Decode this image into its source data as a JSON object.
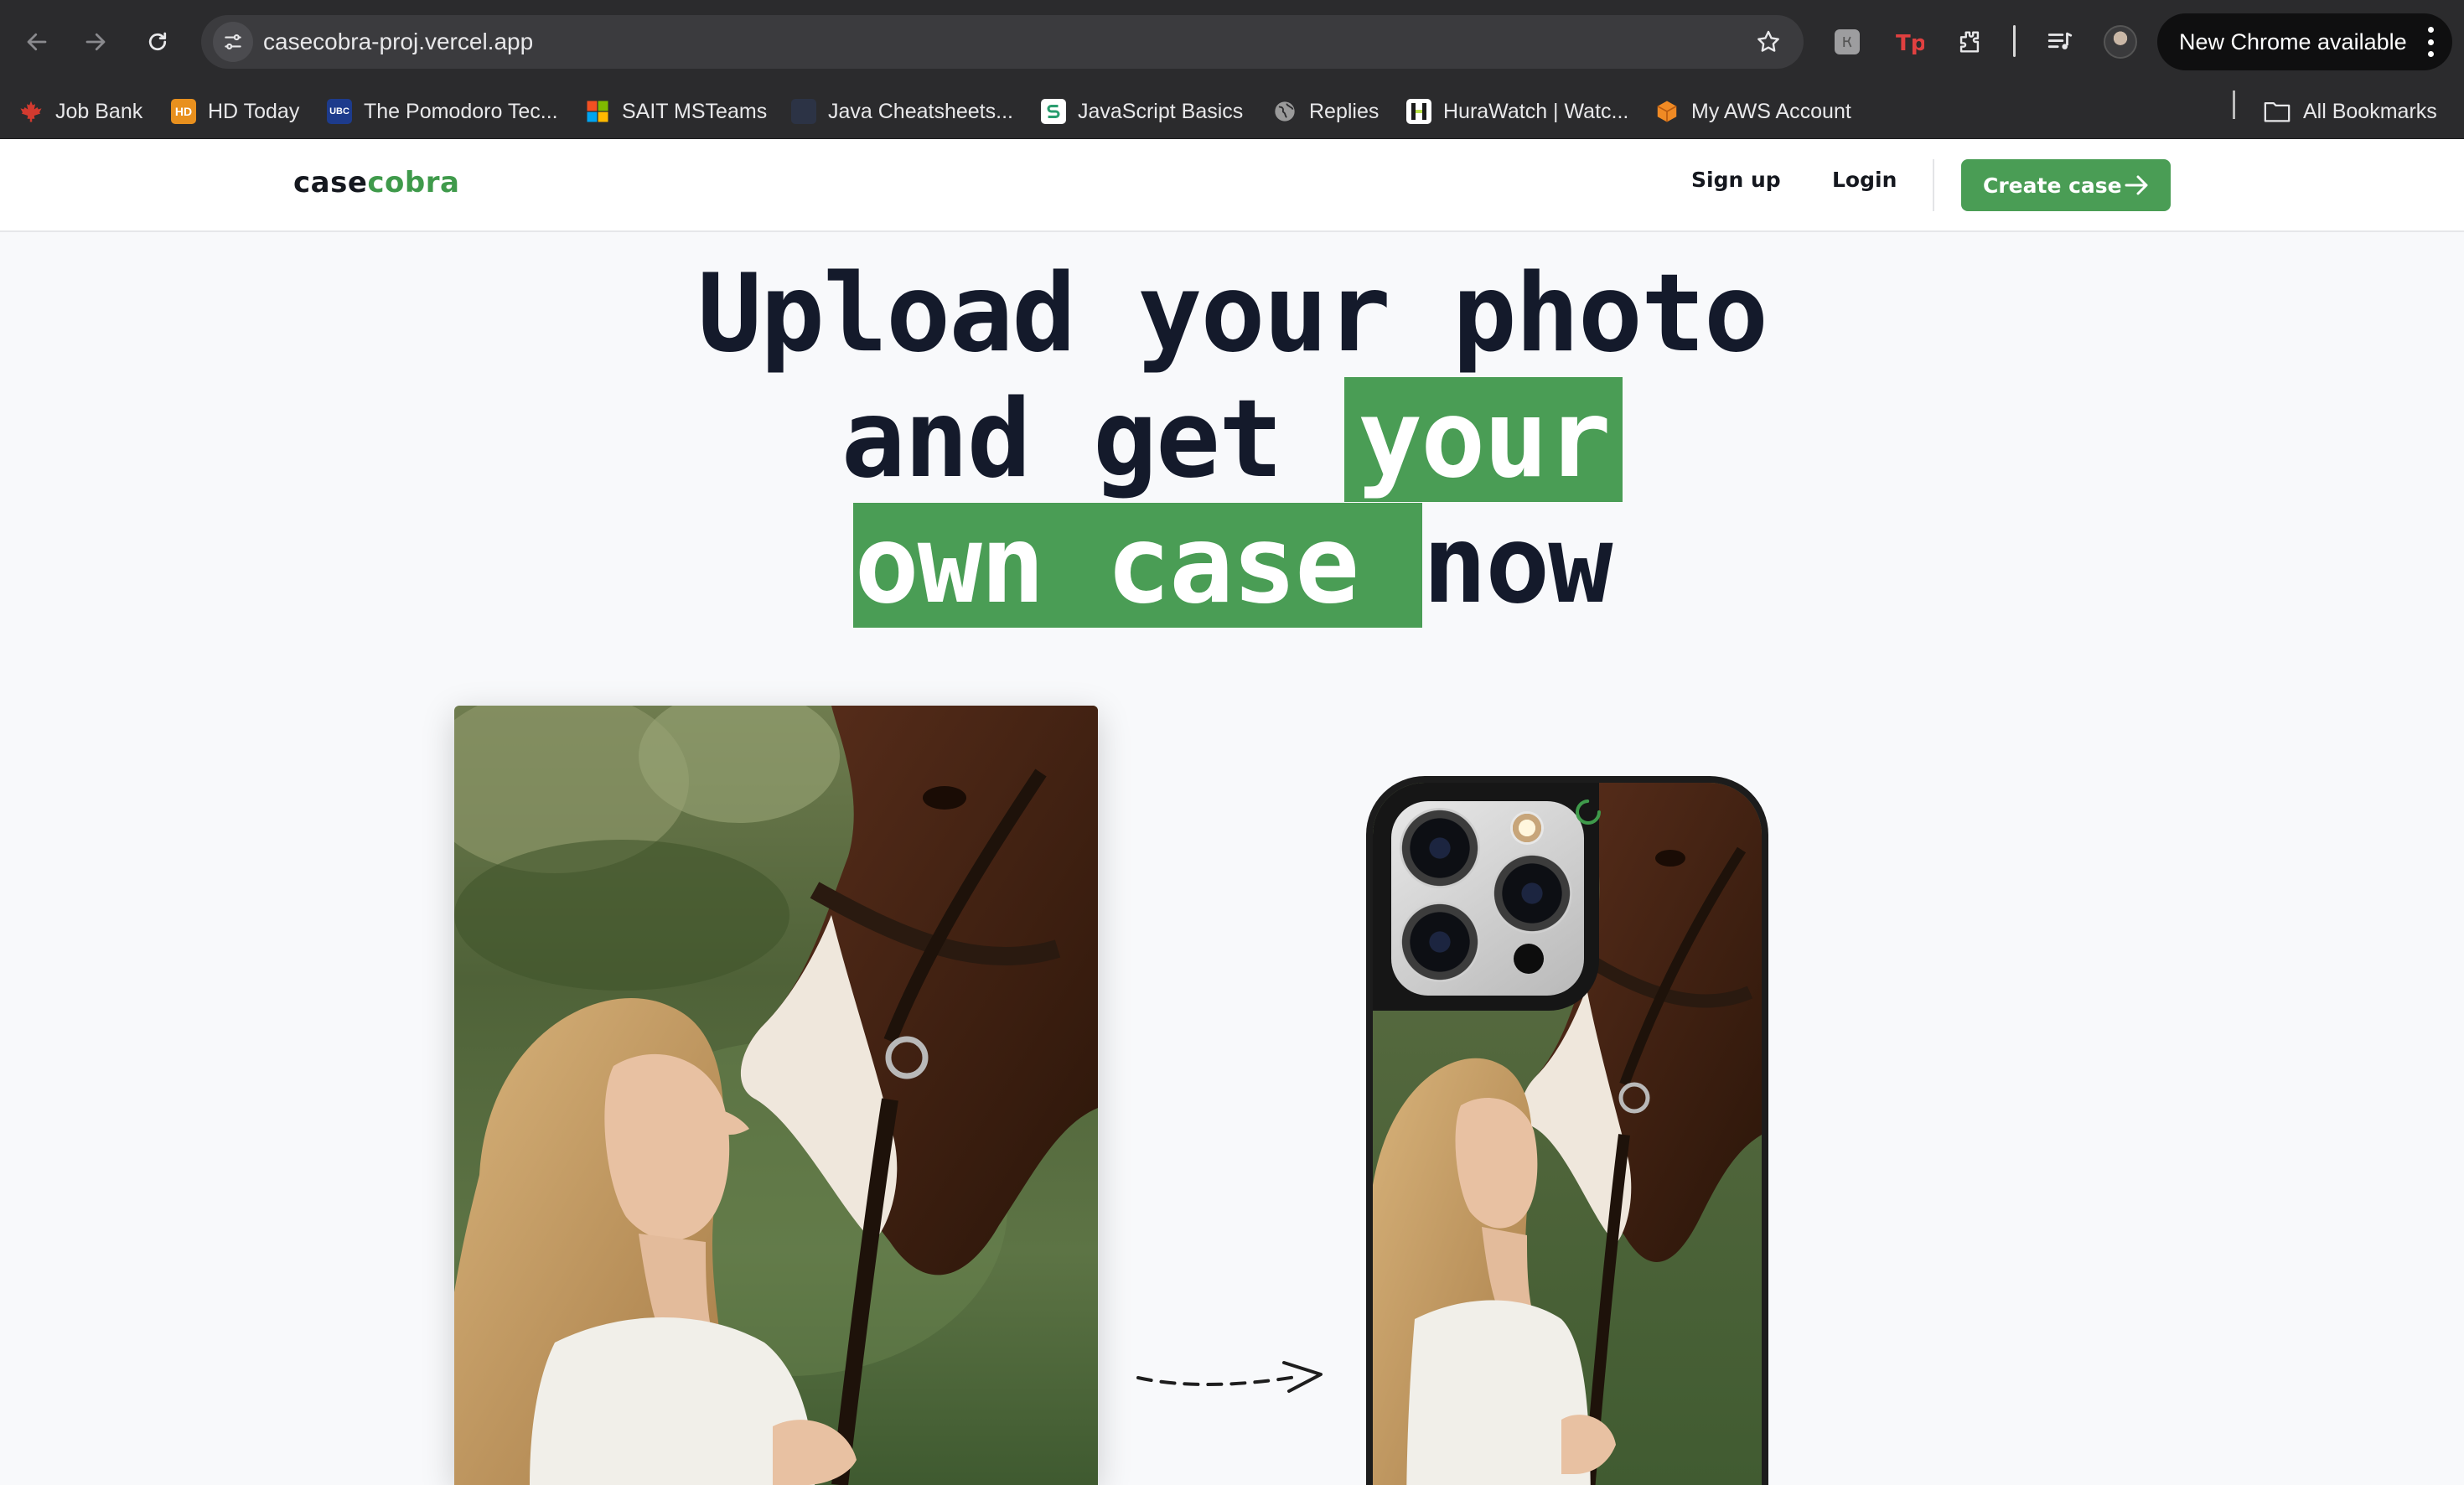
{
  "browser": {
    "url": "casecobra-proj.vercel.app",
    "update_label": "New Chrome available",
    "bookmarks": [
      {
        "label": "Job Bank",
        "icon": "maple-leaf-icon",
        "color": "#d23a2f"
      },
      {
        "label": "HD Today",
        "icon": "hd-icon",
        "color": "#e8901e"
      },
      {
        "label": "The Pomodoro Tec...",
        "icon": "ubc-icon",
        "color": "#1d3b8c"
      },
      {
        "label": "SAIT MSTeams",
        "icon": "microsoft-icon",
        "color": "#f25022"
      },
      {
        "label": "Java Cheatsheets...",
        "icon": "dark-page-icon",
        "color": "#2c3345"
      },
      {
        "label": "JavaScript Basics",
        "icon": "s-logo-icon",
        "color": "#2a9d6f"
      },
      {
        "label": "Replies",
        "icon": "globe-icon",
        "color": "#9a9a9a"
      },
      {
        "label": "HuraWatch | Watc...",
        "icon": "h-logo-icon",
        "color": "#b8e04a"
      },
      {
        "label": "My AWS Account",
        "icon": "aws-cube-icon",
        "color": "#f08a24"
      }
    ],
    "all_bookmarks_label": "All Bookmarks"
  },
  "site": {
    "logo_part1": "case",
    "logo_part2": "cobra",
    "nav": {
      "sign_up": "Sign up",
      "login": "Login",
      "create_case": "Create case"
    },
    "headline": {
      "line1": "Upload your photo",
      "line2_plain": "and get ",
      "line2_highlight": "your",
      "line3_highlight": "own case ",
      "line3_plain": "now"
    },
    "colors": {
      "brand_green": "#4a9d55",
      "text_dark": "#141a2b"
    }
  }
}
